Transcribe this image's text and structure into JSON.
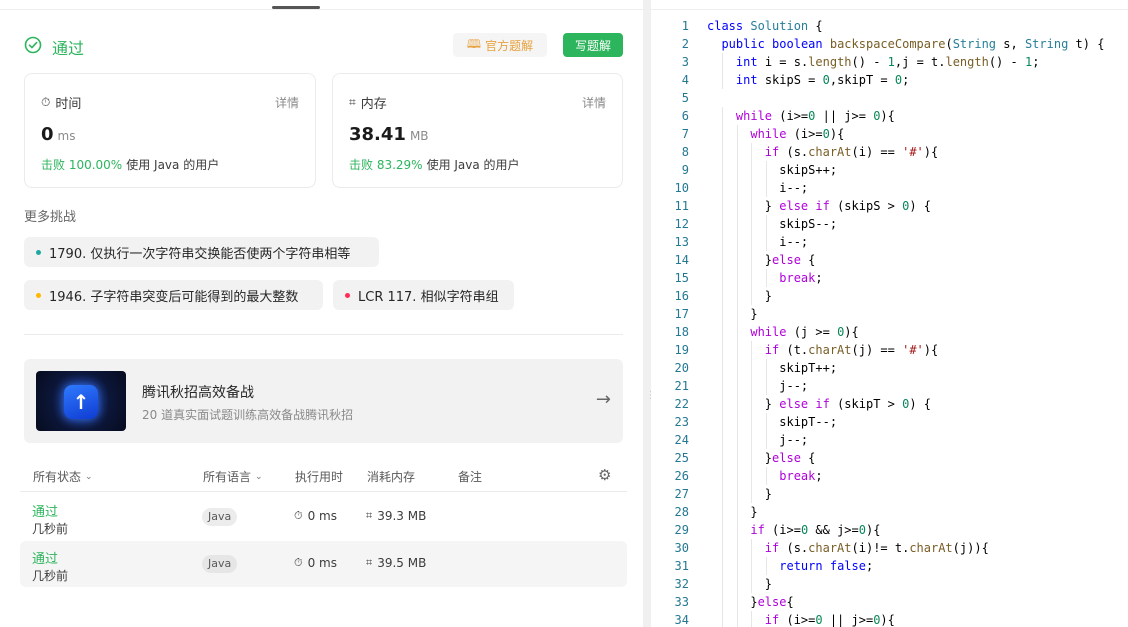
{
  "status": {
    "label": "通过",
    "official_btn": "官方题解",
    "write_btn": "写题解"
  },
  "time_card": {
    "title": "时间",
    "detail": "详情",
    "value": "0",
    "unit": "ms",
    "beat_pct": "击败 100.00%",
    "beat_text": "使用 Java 的用户"
  },
  "mem_card": {
    "title": "内存",
    "detail": "详情",
    "value": "38.41",
    "unit": "MB",
    "beat_pct": "击败 83.29%",
    "beat_text": "使用 Java 的用户"
  },
  "more": {
    "title": "更多挑战",
    "items": [
      {
        "label": "1790. 仅执行一次字符串交换能否使两个字符串相等",
        "color": "#1fa8a0"
      },
      {
        "label": "1946. 子字符串突变后可能得到的最大整数",
        "color": "#ffb800"
      },
      {
        "label": "LCR 117. 相似字符串组",
        "color": "#ff2d55"
      }
    ]
  },
  "promo": {
    "title": "腾讯秋招高效备战",
    "subtitle": "20 道真实面试题训练高效备战腾讯秋招"
  },
  "table": {
    "headers": {
      "status": "所有状态",
      "lang": "所有语言",
      "runtime": "执行用时",
      "memory": "消耗内存",
      "note": "备注"
    },
    "rows": [
      {
        "status": "通过",
        "ago": "几秒前",
        "lang": "Java",
        "runtime": "0 ms",
        "memory": "39.3 MB"
      },
      {
        "status": "通过",
        "ago": "几秒前",
        "lang": "Java",
        "runtime": "0 ms",
        "memory": "39.5 MB"
      }
    ]
  },
  "colors": {
    "accent_green": "#2db55d",
    "official_orange": "#e8a23d"
  },
  "code_lines": [
    "class Solution {",
    "  public boolean backspaceCompare(String s, String t) {",
    "    int i = s.length() - 1,j = t.length() - 1;",
    "    int skipS = 0,skipT = 0;",
    "",
    "    while (i>=0 || j>= 0){",
    "      while (i>=0){",
    "        if (s.charAt(i) == '#'){",
    "          skipS++;",
    "          i--;",
    "        } else if (skipS > 0) {",
    "          skipS--;",
    "          i--;",
    "        }else {",
    "          break;",
    "        }",
    "      }",
    "      while (j >= 0){",
    "        if (t.charAt(j) == '#'){",
    "          skipT++;",
    "          j--;",
    "        } else if (skipT > 0) {",
    "          skipT--;",
    "          j--;",
    "        }else {",
    "          break;",
    "        }",
    "      }",
    "      if (i>=0 && j>=0){",
    "        if (s.charAt(i)!= t.charAt(j)){",
    "          return false;",
    "        }",
    "      }else{",
    "        if (i>=0 || j>=0){"
  ]
}
